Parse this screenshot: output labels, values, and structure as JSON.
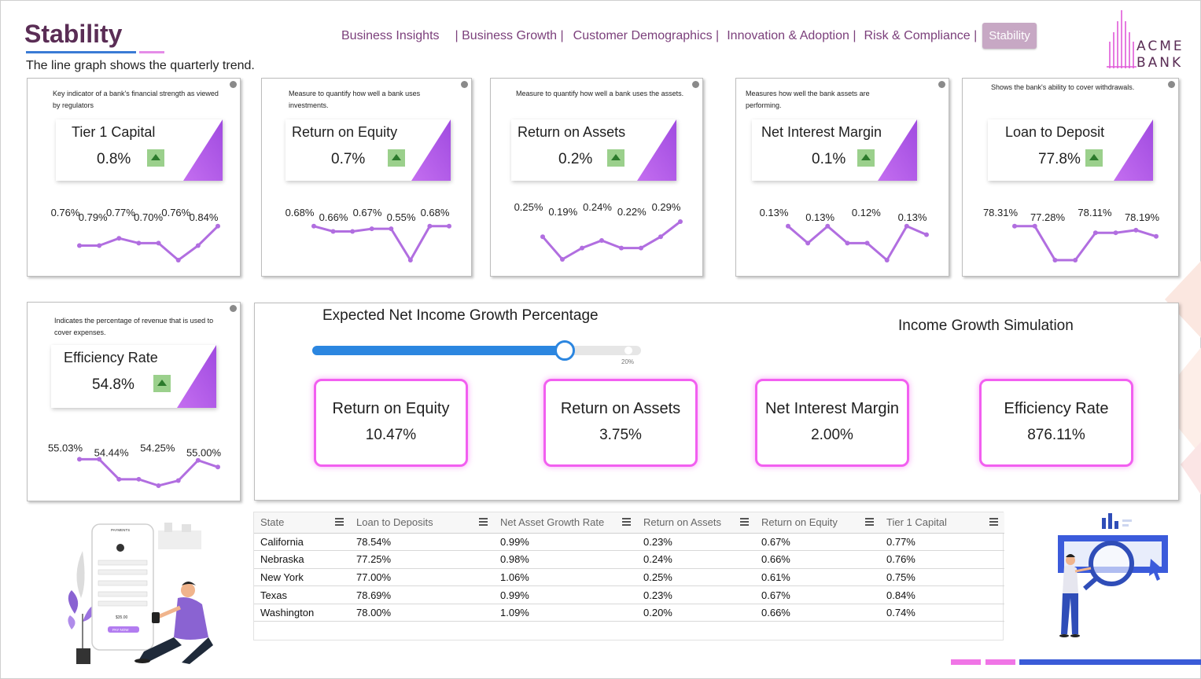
{
  "header": {
    "title": "Stability",
    "subtitle": "The line graph shows the quarterly trend."
  },
  "nav": {
    "items": [
      {
        "label": "Business Insights"
      },
      {
        "label": "| Business Growth |"
      },
      {
        "label": "Customer Demographics |"
      },
      {
        "label": "Innovation & Adoption |"
      },
      {
        "label": "Risk & Compliance |"
      },
      {
        "label": "Stability"
      }
    ]
  },
  "logo": {
    "line1": "ACME",
    "line2": "BANK"
  },
  "kpis": [
    {
      "desc": "Key indicator of a bank's financial strength as viewed by regulators",
      "label": "Tier 1 Capital",
      "value": "0.8%",
      "trend": "up",
      "spark_values": [
        0.76,
        0.76,
        0.79,
        0.77,
        0.77,
        0.7,
        0.76,
        0.84
      ],
      "spark_labels": [
        "0.76%",
        "0.79%",
        "0.77%",
        "0.70%",
        "0.76%",
        "0.84%"
      ]
    },
    {
      "desc": "Measure to quantify how well a bank uses investments.",
      "label": "Return on Equity",
      "value": "0.7%",
      "trend": "up",
      "spark_values": [
        0.68,
        0.66,
        0.66,
        0.67,
        0.67,
        0.55,
        0.68,
        0.68
      ],
      "spark_labels": [
        "0.68%",
        "0.66%",
        "0.67%",
        "0.55%",
        "0.68%"
      ]
    },
    {
      "desc": "Measure to quantify how well a bank uses the assets.",
      "label": "Return on Assets",
      "value": "0.2%",
      "trend": "up",
      "spark_values": [
        0.25,
        0.19,
        0.22,
        0.24,
        0.22,
        0.22,
        0.25,
        0.29
      ],
      "spark_labels": [
        "0.25%",
        "0.19%",
        "0.24%",
        "0.22%",
        "0.29%"
      ]
    },
    {
      "desc": "Measures how well the bank assets are performing.",
      "label": "Net Interest Margin",
      "value": "0.1%",
      "trend": "up",
      "spark_values": [
        0.13,
        0.12,
        0.13,
        0.12,
        0.12,
        0.11,
        0.13,
        0.125
      ],
      "spark_labels": [
        "0.13%",
        "0.13%",
        "0.12%",
        "0.13%"
      ]
    },
    {
      "desc": "Shows the bank's ability to cover withdrawals.",
      "label": "Loan to Deposit",
      "value": "77.8%",
      "trend": "up",
      "spark_values": [
        78.31,
        78.31,
        77.28,
        77.28,
        78.11,
        78.11,
        78.19,
        78.0
      ],
      "spark_labels": [
        "78.31%",
        "77.28%",
        "78.11%",
        "78.19%"
      ]
    },
    {
      "desc": "Indicates the percentage of revenue that is used to cover expenses.",
      "label": "Efficiency Rate",
      "value": "54.8%",
      "trend": "up",
      "spark_values": [
        55.03,
        55.03,
        54.44,
        54.44,
        54.25,
        54.4,
        55.0,
        54.8
      ],
      "spark_labels": [
        "55.03%",
        "54.44%",
        "54.25%",
        "55.00%"
      ]
    }
  ],
  "simulation": {
    "slider_title": "Expected Net Income Growth Percentage",
    "slider_value_fraction": 0.78,
    "slider_max_label": "20%",
    "title": "Income Growth Simulation",
    "cards": [
      {
        "label": "Return on Equity",
        "value": "10.47%"
      },
      {
        "label": "Return on Assets",
        "value": "3.75%"
      },
      {
        "label": "Net Interest Margin",
        "value": "2.00%"
      },
      {
        "label": "Efficiency Rate",
        "value": "876.11%"
      }
    ]
  },
  "table": {
    "columns": [
      "State",
      "Loan to Deposits",
      "Net Asset Growth Rate",
      "Return on Assets",
      "Return on Equity",
      "Tier 1 Capital"
    ],
    "rows": [
      [
        "California",
        "78.54%",
        "0.99%",
        "0.23%",
        "0.67%",
        "0.77%"
      ],
      [
        "Nebraska",
        "77.25%",
        "0.98%",
        "0.24%",
        "0.66%",
        "0.76%"
      ],
      [
        "New York",
        "77.00%",
        "1.06%",
        "0.25%",
        "0.61%",
        "0.75%"
      ],
      [
        "Texas",
        "78.69%",
        "0.99%",
        "0.23%",
        "0.67%",
        "0.84%"
      ],
      [
        "Washington",
        "78.00%",
        "1.09%",
        "0.20%",
        "0.66%",
        "0.74%"
      ]
    ]
  },
  "phone_illustration": {
    "line1": "PAYMENTS",
    "line2": "$35.00",
    "button": "PAY NOW"
  },
  "colors": {
    "accent_purple": "#b25ee8",
    "sparkline": "#b16ee0",
    "slider": "#2b86e0",
    "sim_border": "#f25ff0",
    "title": "#5a2d55",
    "nav": "#7b3f7b",
    "trend_up_bg": "#9bd08c"
  },
  "icons": [
    "info-icon",
    "trend-up-arrow-icon",
    "column-menu-icon",
    "acme-bank-logo-icon"
  ]
}
